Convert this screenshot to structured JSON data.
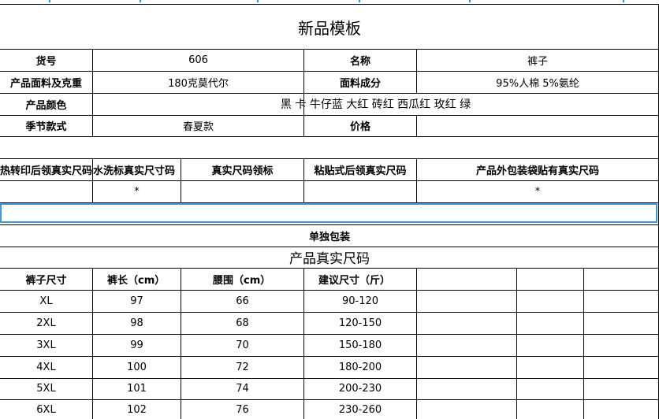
{
  "title": "新品模板",
  "info": {
    "item_no_label": "货号",
    "item_no": "606",
    "name_label": "名称",
    "name": "裤子",
    "fabric_label": "产品面料及克重",
    "fabric": "180克莫代尔",
    "composition_label": "面料成分",
    "composition": "95%人棉 5%氨纶",
    "color_label": "产品颜色",
    "colors": "黑 卡 牛仔蓝 大红 砖红 西瓜红 玫红 绿",
    "season_label": "季节款式",
    "season": "春夏款",
    "price_label": "价格",
    "price": ""
  },
  "labels": {
    "headers": [
      "热转印后领真实尺码",
      "水洗标真实尺寸码",
      "真实尺码领标",
      "粘贴式后领真实尺码",
      "产品外包装袋贴有真实尺码"
    ],
    "marks": [
      "",
      "*",
      "",
      "",
      "*"
    ]
  },
  "packaging": "单独包装",
  "size_section_title": "产品真实尺码",
  "size_table": {
    "columns": [
      "裤子尺寸",
      "裤长（cm）",
      "腰围（cm）",
      "建议尺寸（斤）"
    ],
    "rows": [
      [
        "XL",
        "97",
        "66",
        "90-120"
      ],
      [
        "2XL",
        "98",
        "68",
        "120-150"
      ],
      [
        "3XL",
        "99",
        "70",
        "150-180"
      ],
      [
        "4XL",
        "100",
        "72",
        "180-200"
      ],
      [
        "5XL",
        "101",
        "74",
        "200-230"
      ],
      [
        "6XL",
        "102",
        "76",
        "230-260"
      ]
    ]
  },
  "colors_ui": {
    "selection_border": "#3d9ad8",
    "grid": "#000000"
  }
}
